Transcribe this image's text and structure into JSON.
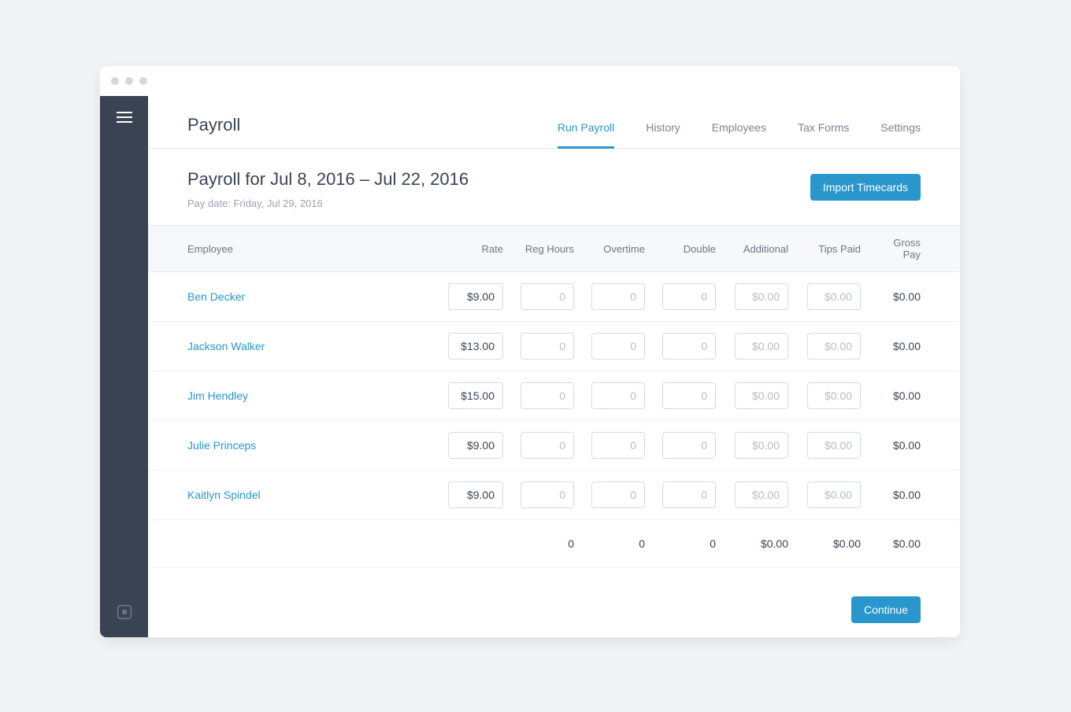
{
  "header": {
    "title": "Payroll",
    "tabs": [
      {
        "label": "Run Payroll",
        "active": true
      },
      {
        "label": "History",
        "active": false
      },
      {
        "label": "Employees",
        "active": false
      },
      {
        "label": "Tax Forms",
        "active": false
      },
      {
        "label": "Settings",
        "active": false
      }
    ]
  },
  "subheader": {
    "title": "Payroll for Jul 8, 2016 – Jul 22, 2016",
    "paydate": "Pay date: Friday, Jul 29, 2016",
    "import_button": "Import Timecards"
  },
  "table": {
    "columns": [
      "Employee",
      "Rate",
      "Reg Hours",
      "Overtime",
      "Double",
      "Additional",
      "Tips Paid",
      "Gross Pay"
    ],
    "rows": [
      {
        "name": "Ben Decker",
        "rate": "$9.00",
        "reg": "",
        "ot": "",
        "dbl": "",
        "add": "",
        "tips": "",
        "gross": "$0.00"
      },
      {
        "name": "Jackson Walker",
        "rate": "$13.00",
        "reg": "",
        "ot": "",
        "dbl": "",
        "add": "",
        "tips": "",
        "gross": "$0.00"
      },
      {
        "name": "Jim Hendley",
        "rate": "$15.00",
        "reg": "",
        "ot": "",
        "dbl": "",
        "add": "",
        "tips": "",
        "gross": "$0.00"
      },
      {
        "name": "Julie Princeps",
        "rate": "$9.00",
        "reg": "",
        "ot": "",
        "dbl": "",
        "add": "",
        "tips": "",
        "gross": "$0.00"
      },
      {
        "name": "Kaitlyn Spindel",
        "rate": "$9.00",
        "reg": "",
        "ot": "",
        "dbl": "",
        "add": "",
        "tips": "",
        "gross": "$0.00"
      }
    ],
    "placeholders": {
      "hours": "0",
      "money": "$0.00"
    },
    "totals": {
      "reg": "0",
      "ot": "0",
      "dbl": "0",
      "add": "$0.00",
      "tips": "$0.00",
      "gross": "$0.00"
    }
  },
  "footer": {
    "continue": "Continue"
  }
}
